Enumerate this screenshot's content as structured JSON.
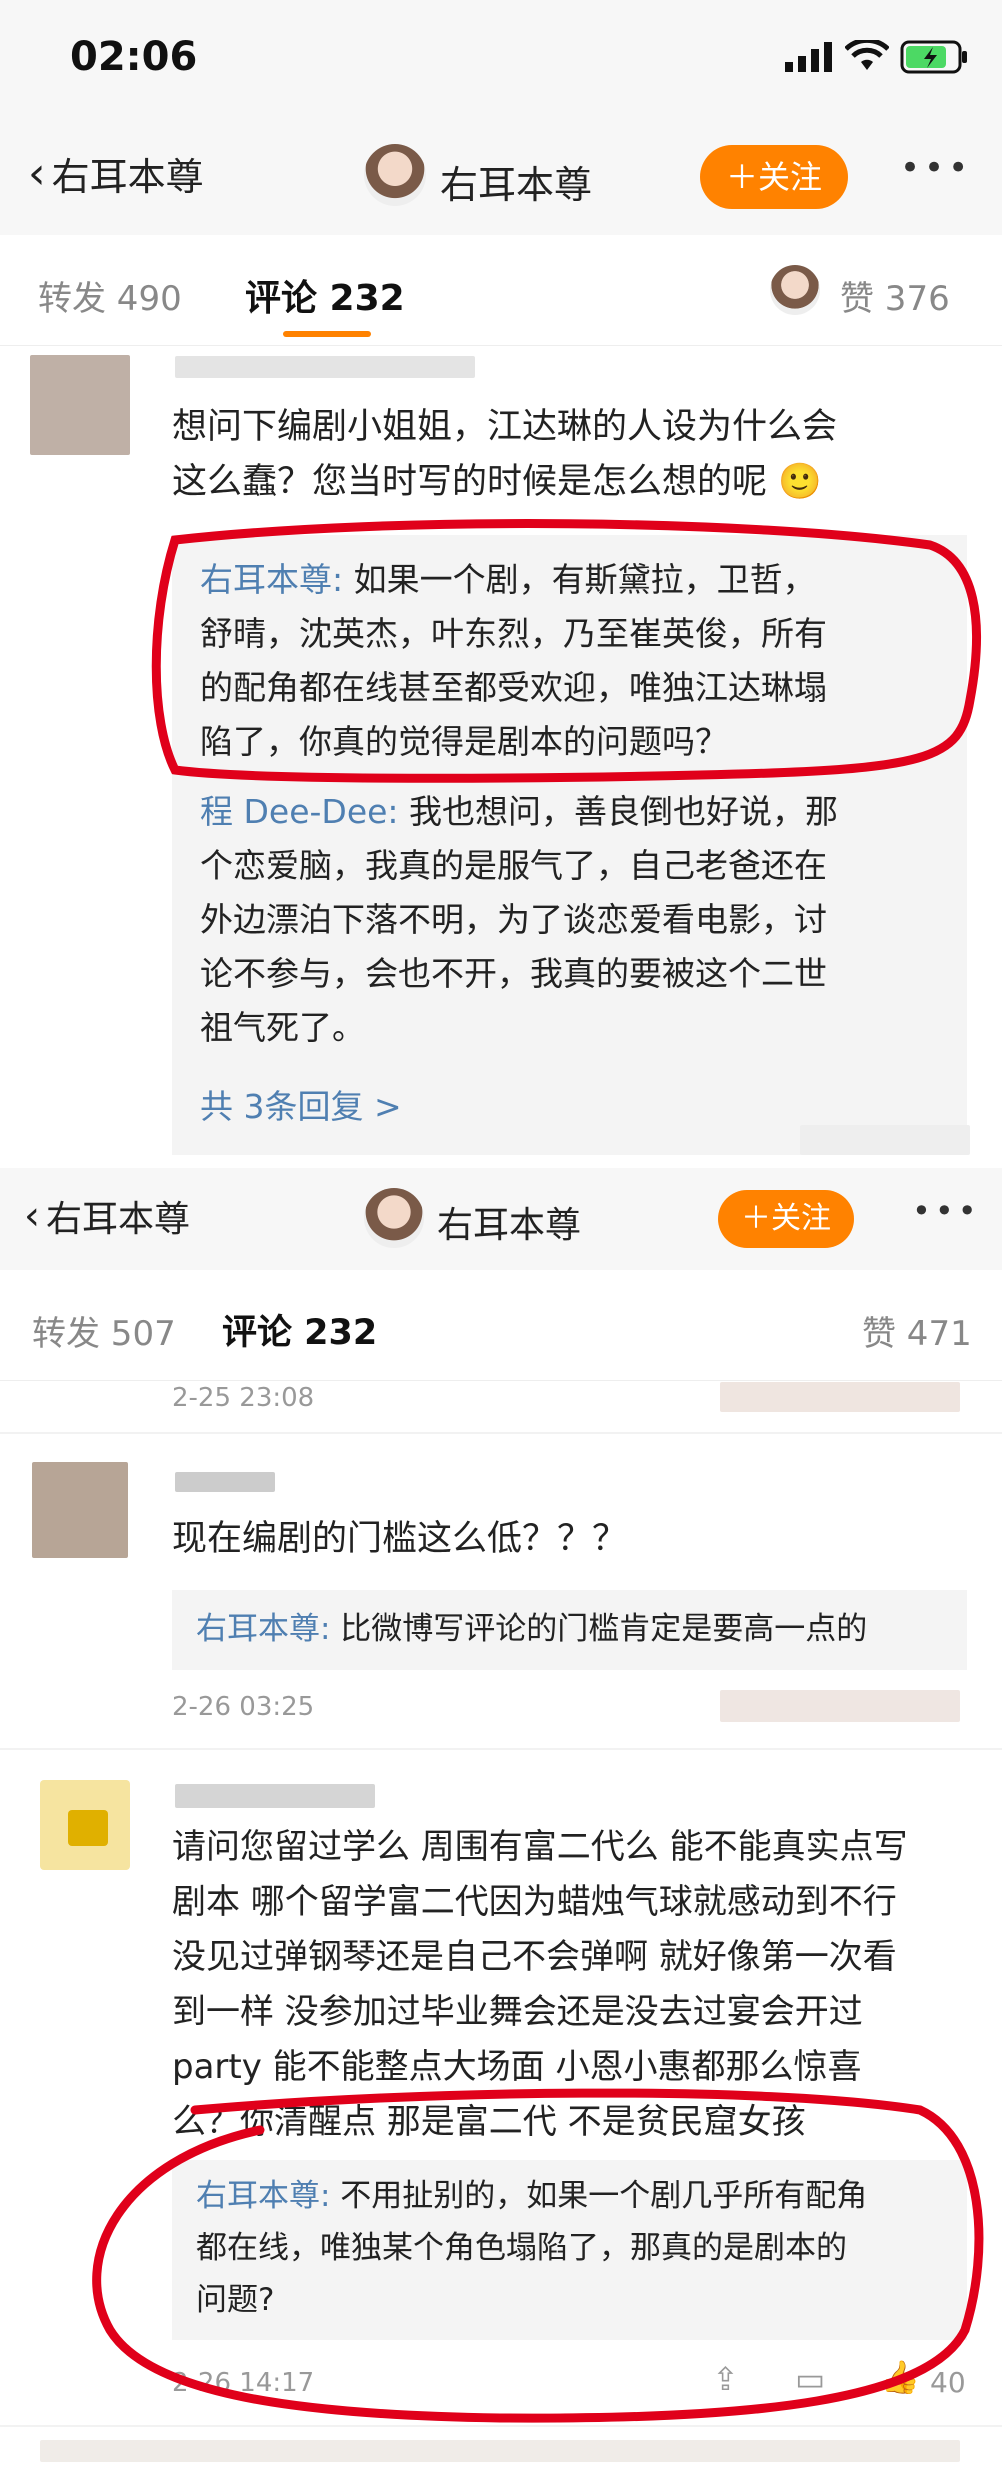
{
  "status_bar": {
    "time": "02:06"
  },
  "screen1": {
    "nav": {
      "title": "右耳本尊",
      "back_label": "右耳本尊",
      "follow_label": "＋关注",
      "more": "•••"
    },
    "tabs": {
      "repost": "转发 490",
      "comment": "评论 232",
      "like": "赞 376"
    },
    "comment": {
      "lines": [
        "想问下编剧小姐姐，江达琳的人设为什么会",
        "这么蠢？您当时写的时候是怎么想的呢 🙂"
      ],
      "replies": [
        {
          "name": "右耳本尊:",
          "lines": [
            " 如果一个剧，有斯黛拉，卫哲，",
            "舒晴，沈英杰，叶东烈，乃至崔英俊，所有",
            "的配角都在线甚至都受欢迎，唯独江达琳塌",
            "陷了，你真的觉得是剧本的问题吗？"
          ]
        },
        {
          "name": "程 Dee-Dee:",
          "lines": [
            " 我也想问，善良倒也好说，那",
            "个恋爱脑，我真的是服气了，自己老爸还在",
            "外边漂泊下落不明，为了谈恋爱看电影，讨",
            "论不参与，会也不开，我真的要被这个二世",
            "祖气死了。"
          ]
        }
      ],
      "more_replies": "共 3条回复 >"
    }
  },
  "screen2": {
    "nav": {
      "title": "右耳本尊",
      "back_label": "右耳本尊",
      "follow_label": "＋关注",
      "more": "•••"
    },
    "tabs": {
      "repost": "转发 507",
      "comment": "评论 232",
      "like": "赞 471"
    },
    "time_top": "2-25 23:08",
    "comment_a": {
      "text": "现在编剧的门槛这么低？？？",
      "reply_name": "右耳本尊:",
      "reply_text": " 比微博写评论的门槛肯定是要高一点的",
      "time": "2-26 03:25"
    },
    "comment_b": {
      "lines": [
        "请问您留过学么 周围有富二代么 能不能真实点写",
        "剧本 哪个留学富二代因为蜡烛气球就感动到不行",
        "没见过弹钢琴还是自己不会弹啊 就好像第一次看",
        "到一样 没参加过毕业舞会还是没去过宴会开过",
        "party 能不能整点大场面 小恩小惠都那么惊喜",
        "么？你清醒点 那是富二代 不是贫民窟女孩"
      ],
      "reply_name": "右耳本尊:",
      "reply_lines": [
        " 不用扯别的，如果一个剧几乎所有配角",
        "都在线，唯独某个角色塌陷了，那真的是剧本的",
        "问题?"
      ],
      "time": "2-26 14:17",
      "like_count": "40"
    }
  },
  "colors": {
    "accent": "#ff8200",
    "link": "#4f7fb1",
    "annotation": "#e0001a"
  }
}
